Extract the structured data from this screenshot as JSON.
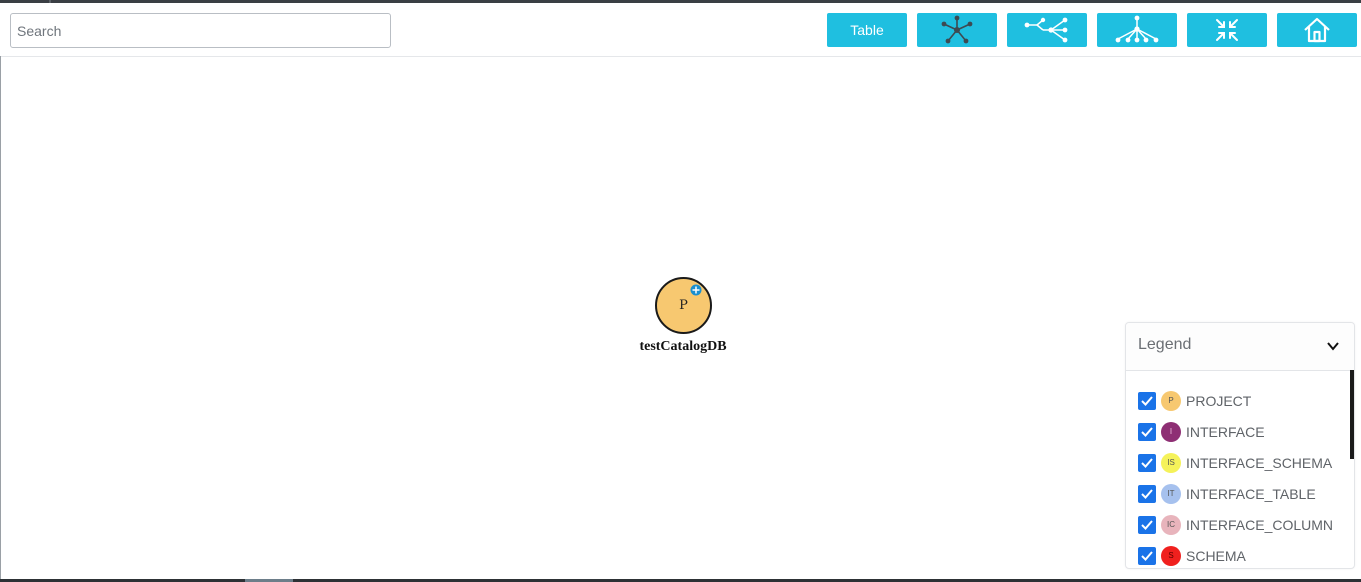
{
  "search": {
    "placeholder": "Search",
    "value": ""
  },
  "toolbar": {
    "table_label": "Table",
    "buttons": [
      {
        "name": "radial-layout-button",
        "icon": "star-graph-icon"
      },
      {
        "name": "tree-horizontal-layout-button",
        "icon": "horizontal-tree-icon"
      },
      {
        "name": "tree-vertical-layout-button",
        "icon": "vertical-tree-icon"
      },
      {
        "name": "collapse-button",
        "icon": "collapse-arrows-icon"
      },
      {
        "name": "home-button",
        "icon": "home-icon"
      }
    ],
    "accent": "#1fbfe0"
  },
  "graph": {
    "node": {
      "letter": "P",
      "label": "testCatalogDB",
      "color": "#f7c870"
    }
  },
  "legend": {
    "title": "Legend",
    "items": [
      {
        "code": "P",
        "label": "PROJECT",
        "color": "#f7c870",
        "checked": true
      },
      {
        "code": "I",
        "label": "INTERFACE",
        "color": "#8e2f74",
        "checked": true
      },
      {
        "code": "IS",
        "label": "INTERFACE_SCHEMA",
        "color": "#f5f25a",
        "checked": true
      },
      {
        "code": "IT",
        "label": "INTERFACE_TABLE",
        "color": "#a6c1ee",
        "checked": true
      },
      {
        "code": "IC",
        "label": "INTERFACE_COLUMN",
        "color": "#e8b4bc",
        "checked": true
      },
      {
        "code": "S",
        "label": "SCHEMA",
        "color": "#f0201e",
        "checked": true
      }
    ]
  }
}
